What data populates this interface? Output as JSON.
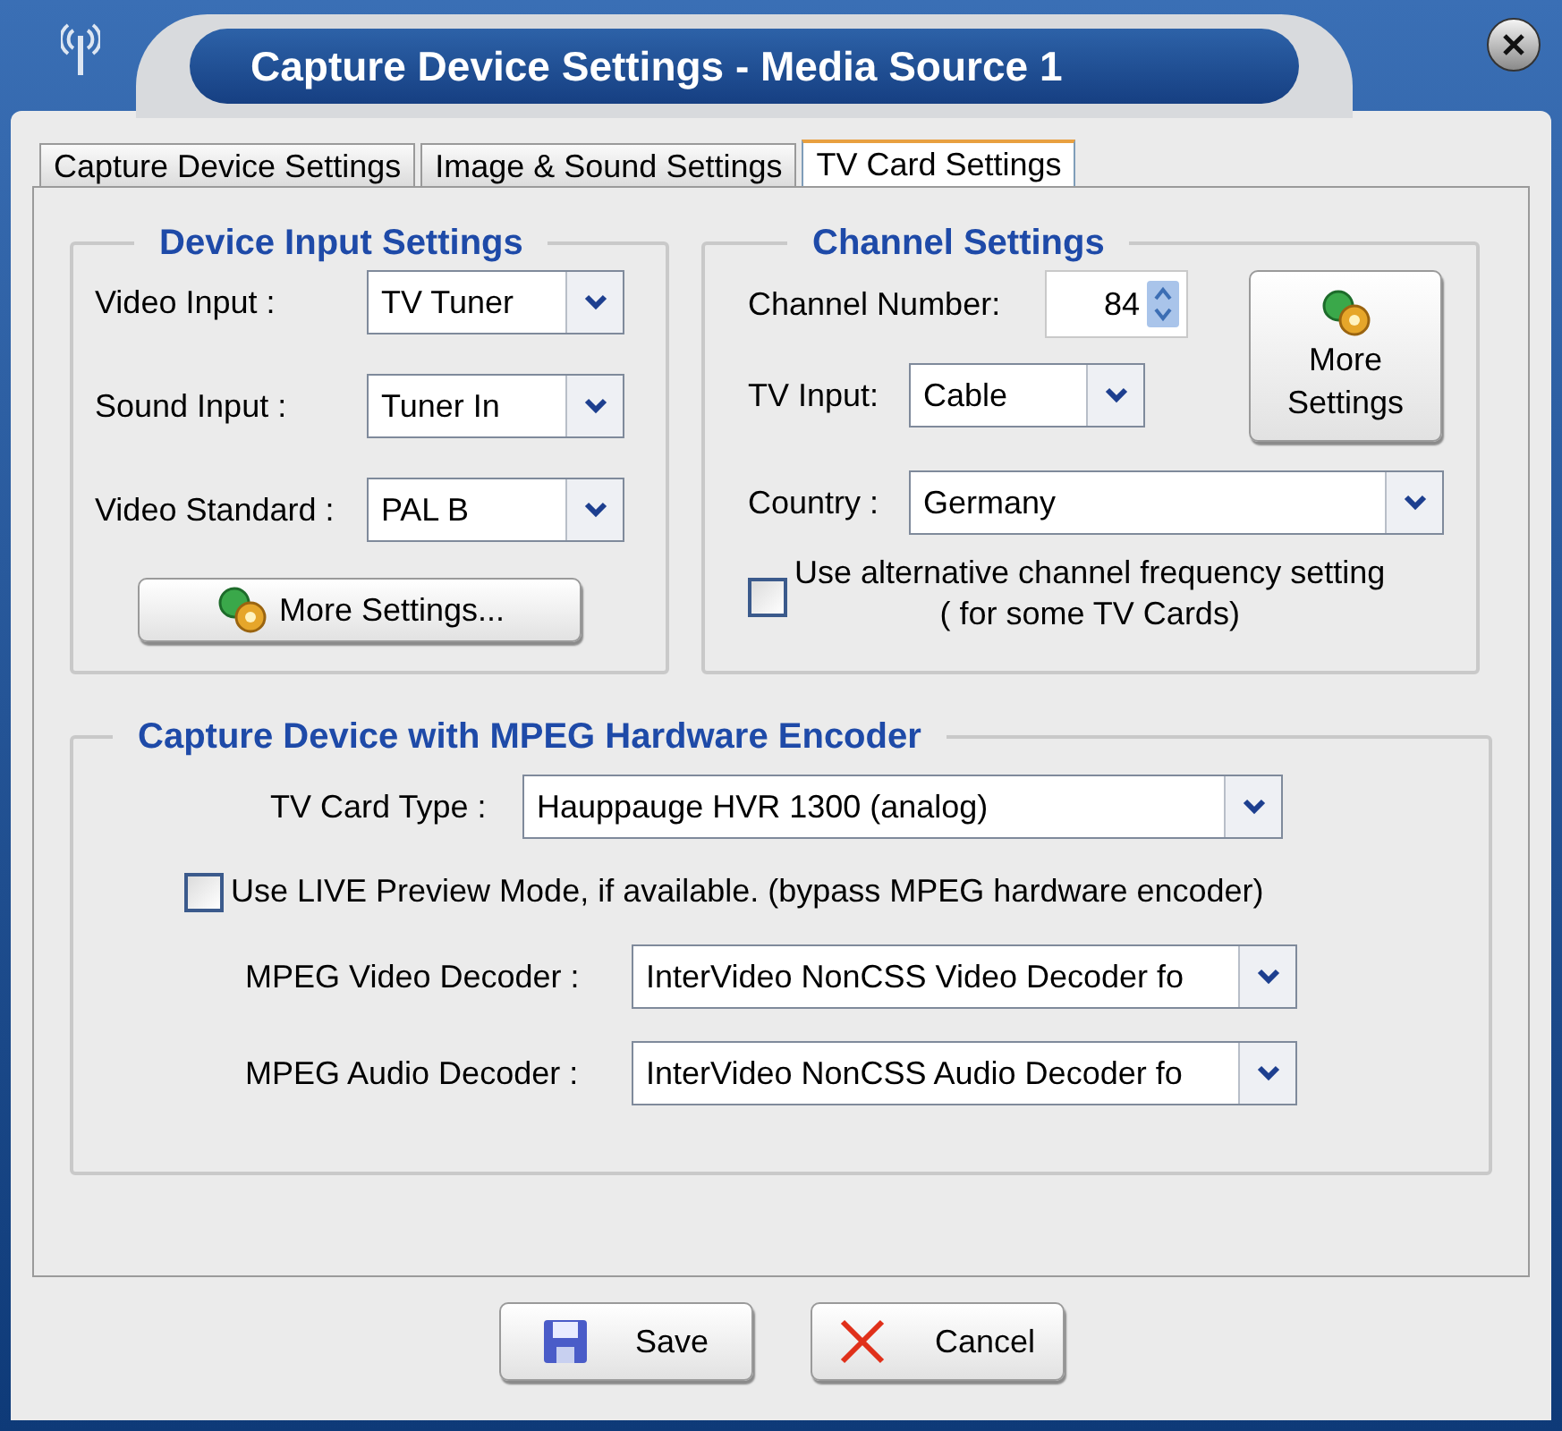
{
  "window": {
    "title": "Capture Device Settings - Media Source 1"
  },
  "tabs": [
    {
      "label": "Capture Device Settings",
      "selected": false
    },
    {
      "label": "Image & Sound Settings",
      "selected": false
    },
    {
      "label": "TV Card Settings",
      "selected": true
    }
  ],
  "device_input": {
    "title": "Device Input Settings",
    "fields": [
      {
        "label": "Video Input :",
        "value": "TV Tuner"
      },
      {
        "label": "Sound Input :",
        "value": "Tuner In"
      },
      {
        "label": "Video Standard :",
        "value": "PAL B"
      }
    ],
    "button": "More Settings..."
  },
  "channel": {
    "title": "Channel Settings",
    "channel_number": {
      "label": "Channel Number:",
      "value": "84"
    },
    "tv_input": {
      "label": "TV Input:",
      "value": "Cable"
    },
    "more_button": "More Settings",
    "country": {
      "label": "Country :",
      "value": "Germany"
    },
    "alt_frequency": {
      "label_lines": [
        "Use alternative channel frequency setting",
        "( for some TV Cards)"
      ],
      "checked": false
    }
  },
  "mpeg": {
    "title": "Capture Device with MPEG Hardware Encoder",
    "card_type": {
      "label": "TV Card Type :",
      "value": "Hauppauge HVR 1300 (analog)"
    },
    "live_preview": {
      "label": "Use LIVE Preview Mode, if available. (bypass MPEG hardware encoder)",
      "checked": false
    },
    "decoders": [
      {
        "label": "MPEG Video Decoder :",
        "value": "InterVideo NonCSS Video Decoder fo"
      },
      {
        "label": "MPEG Audio Decoder :",
        "value": "InterVideo NonCSS Audio Decoder fo"
      }
    ]
  },
  "buttons": [
    {
      "kind": "save",
      "label": "Save"
    },
    {
      "kind": "cancel",
      "label": "Cancel"
    }
  ]
}
